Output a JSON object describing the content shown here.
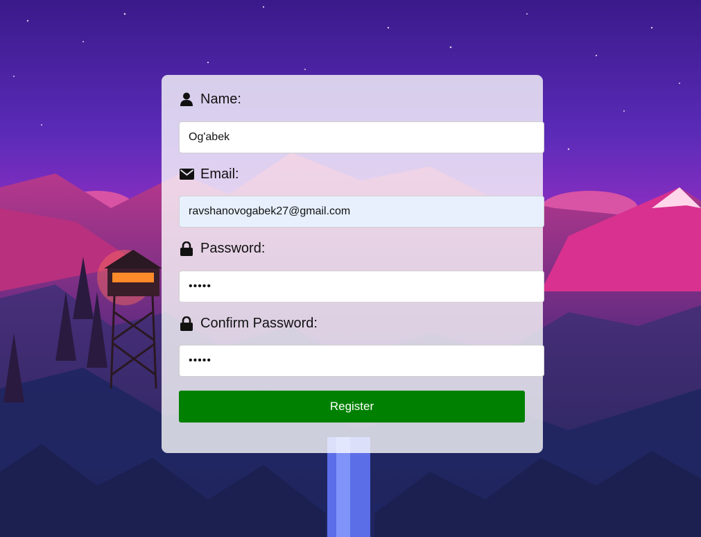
{
  "form": {
    "name_label": "Name:",
    "name_value": "Og'abek",
    "email_label": "Email:",
    "email_value": "ravshanovogabek27@gmail.com",
    "password_label": "Password:",
    "password_value": "12345",
    "confirm_label": "Confirm Password:",
    "confirm_value": "12345",
    "register_label": "Register"
  },
  "icons": {
    "name": "user-icon",
    "email": "envelope-icon",
    "password": "lock-icon",
    "confirm": "lock-icon"
  },
  "colors": {
    "register_button": "#008000",
    "autofill_background": "#e8f0fe"
  }
}
